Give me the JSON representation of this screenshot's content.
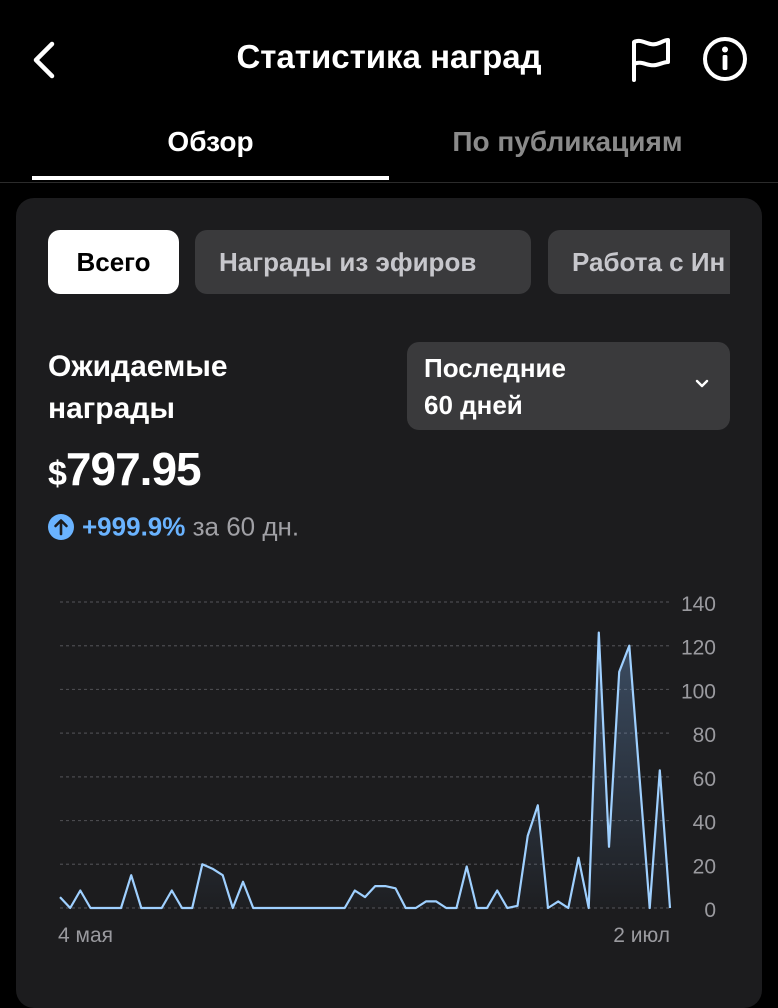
{
  "header": {
    "title": "Статистика наград",
    "back_icon": "chevron-left-icon",
    "flag_icon": "flag-icon",
    "info_icon": "info-icon"
  },
  "tabs": [
    {
      "label": "Обзор",
      "active": true
    },
    {
      "label": "По публикациям",
      "active": false
    }
  ],
  "filters": [
    {
      "label": "Всего",
      "active": true
    },
    {
      "label": "Награды из эфиров",
      "active": false
    },
    {
      "label": "Работа с Ин",
      "active": false
    }
  ],
  "summary": {
    "label_line1": "Ожидаемые",
    "label_line2": "награды",
    "currency": "$",
    "amount": "797.95",
    "growth_pct": "+999.9%",
    "growth_text": "за 60 дн."
  },
  "period": {
    "line1": "Последние",
    "line2": "60 дней",
    "icon": "chevron-down-icon"
  },
  "colors": {
    "accent": "#6ab3ff",
    "line": "#9fd0ff",
    "card": "#1c1c1e",
    "chip": "#3a3a3c"
  },
  "chart_data": {
    "type": "line",
    "x_tick_labels": [
      "4 мая",
      "2 июл"
    ],
    "y_ticks": [
      0,
      20,
      40,
      60,
      80,
      100,
      120,
      140
    ],
    "ylim": [
      0,
      140
    ],
    "grid": true,
    "series": [
      {
        "values": [
          5,
          0,
          8,
          0,
          0,
          0,
          0,
          15,
          0,
          0,
          0,
          8,
          0,
          0,
          20,
          18,
          15,
          0,
          12,
          0,
          0,
          0,
          0,
          0,
          0,
          0,
          0,
          0,
          0,
          8,
          5,
          10,
          10,
          9,
          0,
          0,
          3,
          3,
          0,
          0,
          19,
          0,
          0,
          8,
          0,
          1,
          33,
          47,
          0,
          3,
          0,
          23,
          0,
          126,
          28,
          108,
          120,
          60,
          0,
          63,
          0
        ]
      }
    ]
  }
}
